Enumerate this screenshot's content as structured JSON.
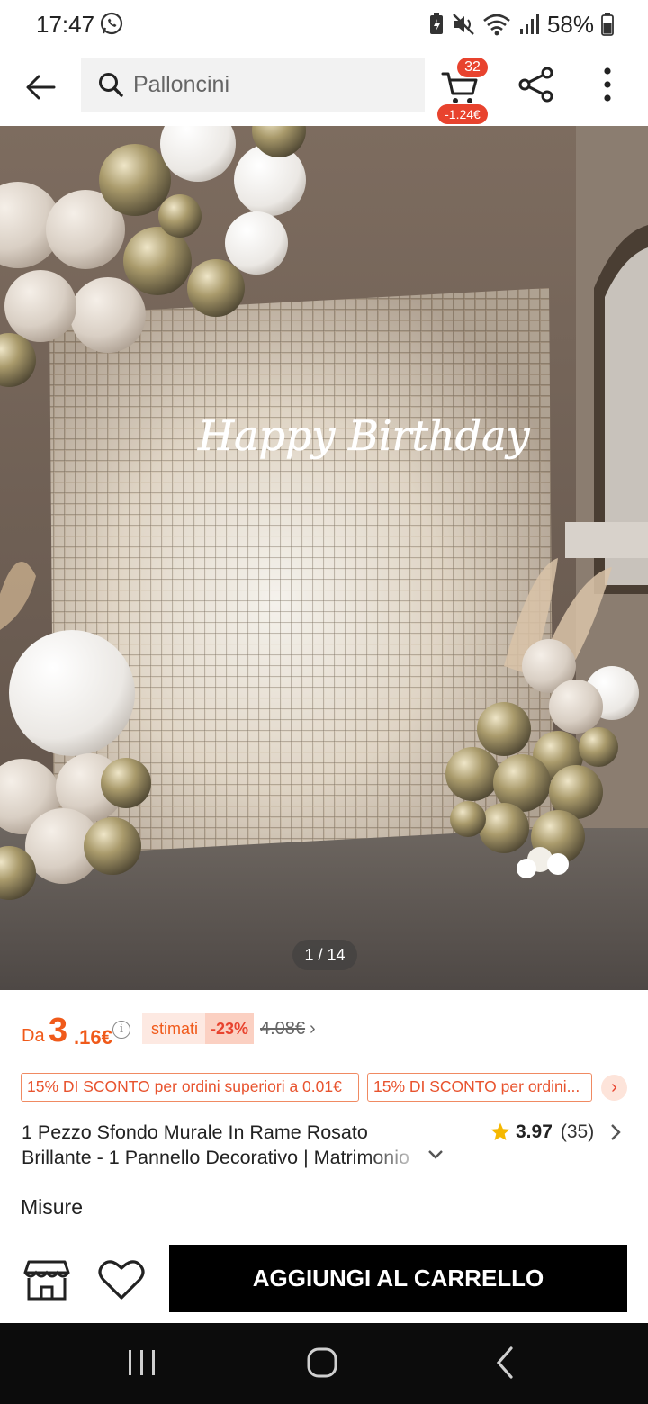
{
  "status_bar": {
    "time": "17:47",
    "battery": "58%",
    "icons": [
      "whatsapp-icon",
      "battery-saver-icon",
      "mute-icon",
      "wifi-icon",
      "signal-icon",
      "battery-icon"
    ]
  },
  "header": {
    "search_placeholder": "Palloncini",
    "cart_count": "32",
    "cart_savings": "-1.24€",
    "icons": [
      "back-arrow-icon",
      "search-icon",
      "cart-icon",
      "share-icon",
      "more-vertical-icon"
    ]
  },
  "gallery": {
    "counter": "1 / 14",
    "neon_text": "Happy Birthday"
  },
  "price": {
    "prefix": "Da",
    "integer": "3",
    "decimal": ".16€",
    "estimated_label": "stimati",
    "discount": "-23%",
    "original": "4.08€",
    "chevron": "›"
  },
  "coupons": [
    "15% DI SCONTO per ordini superiori a 0.01€",
    "15% DI SCONTO per ordini..."
  ],
  "coupon_more": "›",
  "product": {
    "title_line1": "1 Pezzo Sfondo Murale In Rame Rosato",
    "title_line2": "Brillante - 1 Pannello Decorativo | Matrimonio",
    "rating": "3.97",
    "reviews": "(35)"
  },
  "sections": {
    "size_label": "Misure"
  },
  "actions": {
    "add_to_cart": "AGGIUNGI AL CARRELLO"
  },
  "colors": {
    "accent": "#f05a1a",
    "badge": "#e8432e",
    "button": "#000000",
    "star": "#f5b800"
  }
}
